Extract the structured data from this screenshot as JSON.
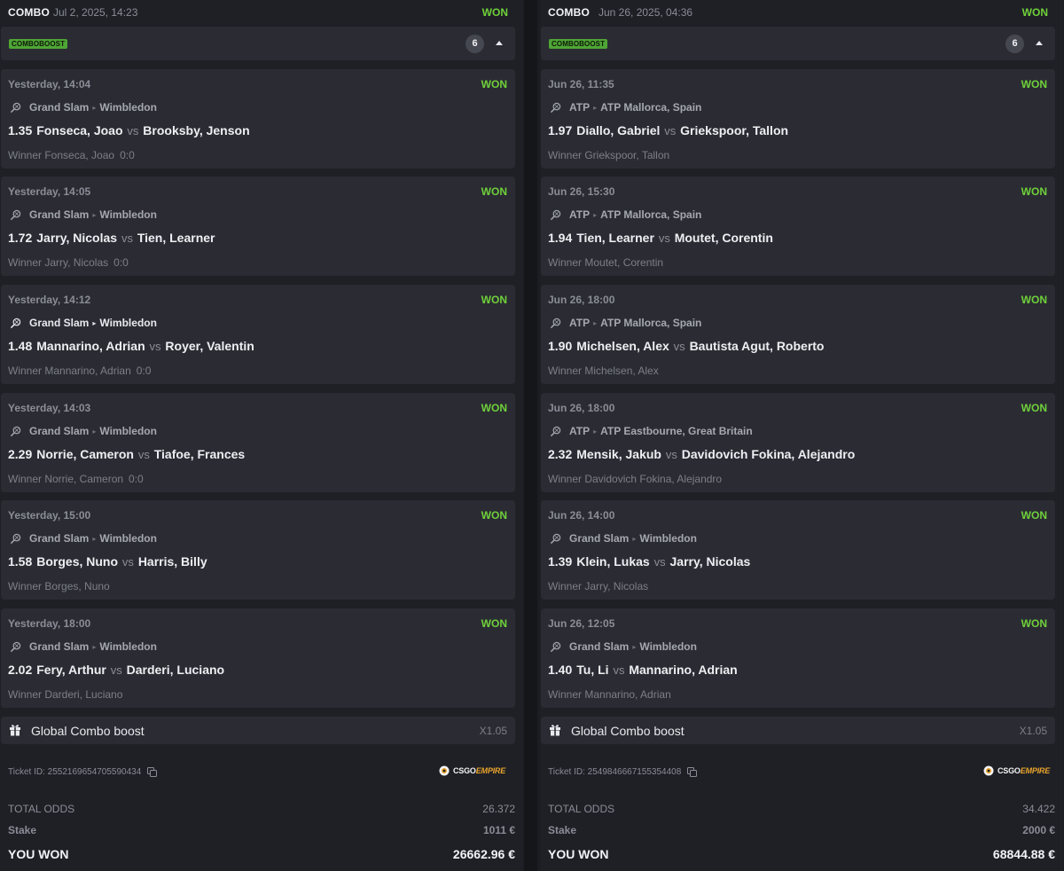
{
  "tickets": [
    {
      "type": "COMBO",
      "date": "Jul 2, 2025, 14:23",
      "status": "WON",
      "boost_badge": "COMBOBOOST",
      "leg_count": "6",
      "legs": [
        {
          "time": "Yesterday, 14:04",
          "status": "WON",
          "category": "Grand Slam",
          "tournament": "Wimbledon",
          "odds": "1.35",
          "home": "Fonseca, Joao",
          "vs": "vs",
          "away": "Brooksby, Jenson",
          "selection": "Winner Fonseca, Joao",
          "score": "0:0"
        },
        {
          "time": "Yesterday, 14:05",
          "status": "WON",
          "category": "Grand Slam",
          "tournament": "Wimbledon",
          "odds": "1.72",
          "home": "Jarry, Nicolas",
          "vs": "vs",
          "away": "Tien, Learner",
          "selection": "Winner Jarry, Nicolas",
          "score": "0:0"
        },
        {
          "time": "Yesterday, 14:12",
          "status": "WON",
          "category": "Grand Slam",
          "tournament": "Wimbledon",
          "odds": "1.48",
          "home": "Mannarino, Adrian",
          "vs": "vs",
          "away": "Royer, Valentin",
          "selection": "Winner Mannarino, Adrian",
          "score": "0:0"
        },
        {
          "time": "Yesterday, 14:03",
          "status": "WON",
          "category": "Grand Slam",
          "tournament": "Wimbledon",
          "odds": "2.29",
          "home": "Norrie, Cameron",
          "vs": "vs",
          "away": "Tiafoe, Frances",
          "selection": "Winner Norrie, Cameron",
          "score": "0:0"
        },
        {
          "time": "Yesterday, 15:00",
          "status": "WON",
          "category": "Grand Slam",
          "tournament": "Wimbledon",
          "odds": "1.58",
          "home": "Borges, Nuno",
          "vs": "vs",
          "away": "Harris, Billy",
          "selection": "Winner Borges, Nuno",
          "score": ""
        },
        {
          "time": "Yesterday, 18:00",
          "status": "WON",
          "category": "Grand Slam",
          "tournament": "Wimbledon",
          "odds": "2.02",
          "home": "Fery, Arthur",
          "vs": "vs",
          "away": "Darderi, Luciano",
          "selection": "Winner Darderi, Luciano",
          "score": ""
        }
      ],
      "global_boost_label": "Global Combo boost",
      "global_boost_mult": "X1.05",
      "ticket_id": "Ticket ID: 2552169654705590434",
      "brand_a": "CSGO",
      "brand_b": "EMPIRE",
      "total_odds_label": "TOTAL ODDS",
      "total_odds": "26.372",
      "stake_label": "Stake",
      "stake": "1011 €",
      "won_label": "YOU WON",
      "won": "26662.96 €"
    },
    {
      "type": "COMBO",
      "date": "Jun 26, 2025, 04:36",
      "status": "WON",
      "boost_badge": "COMBOBOOST",
      "leg_count": "6",
      "legs": [
        {
          "time": "Jun 26, 11:35",
          "status": "WON",
          "category": "ATP",
          "tournament": "ATP Mallorca, Spain",
          "odds": "1.97",
          "home": "Diallo, Gabriel",
          "vs": "vs",
          "away": "Griekspoor, Tallon",
          "selection": "Winner Griekspoor, Tallon",
          "score": ""
        },
        {
          "time": "Jun 26, 15:30",
          "status": "WON",
          "category": "ATP",
          "tournament": "ATP Mallorca, Spain",
          "odds": "1.94",
          "home": "Tien, Learner",
          "vs": "vs",
          "away": "Moutet, Corentin",
          "selection": "Winner Moutet, Corentin",
          "score": ""
        },
        {
          "time": "Jun 26, 18:00",
          "status": "WON",
          "category": "ATP",
          "tournament": "ATP Mallorca, Spain",
          "odds": "1.90",
          "home": "Michelsen, Alex",
          "vs": "vs",
          "away": "Bautista Agut, Roberto",
          "selection": "Winner Michelsen, Alex",
          "score": ""
        },
        {
          "time": "Jun 26, 18:00",
          "status": "WON",
          "category": "ATP",
          "tournament": "ATP Eastbourne, Great Britain",
          "odds": "2.32",
          "home": "Mensik, Jakub",
          "vs": "vs",
          "away": "Davidovich Fokina, Alejandro",
          "selection": "Winner Davidovich Fokina, Alejandro",
          "score": ""
        },
        {
          "time": "Jun 26, 14:00",
          "status": "WON",
          "category": "Grand Slam",
          "tournament": "Wimbledon",
          "odds": "1.39",
          "home": "Klein, Lukas",
          "vs": "vs",
          "away": "Jarry, Nicolas",
          "selection": "Winner Jarry, Nicolas",
          "score": ""
        },
        {
          "time": "Jun 26, 12:05",
          "status": "WON",
          "category": "Grand Slam",
          "tournament": "Wimbledon",
          "odds": "1.40",
          "home": "Tu, Li",
          "vs": "vs",
          "away": "Mannarino, Adrian",
          "selection": "Winner Mannarino, Adrian",
          "score": ""
        }
      ],
      "global_boost_label": "Global Combo boost",
      "global_boost_mult": "X1.05",
      "ticket_id": "Ticket ID: 2549846667155354408",
      "brand_a": "CSGO",
      "brand_b": "EMPIRE",
      "total_odds_label": "TOTAL ODDS",
      "total_odds": "34.422",
      "stake_label": "Stake",
      "stake": "2000 €",
      "won_label": "YOU WON",
      "won": "68844.88 €"
    }
  ],
  "icons": {
    "sport": "tennis-racket-icon",
    "gift": "gift-icon",
    "copy": "copy-icon",
    "collapse": "chevron-up-icon",
    "brand": "csgoempire-logo"
  },
  "colors": {
    "won": "#6fd13a",
    "badge": "#4fa535",
    "brand_accent": "#e8a42c"
  }
}
